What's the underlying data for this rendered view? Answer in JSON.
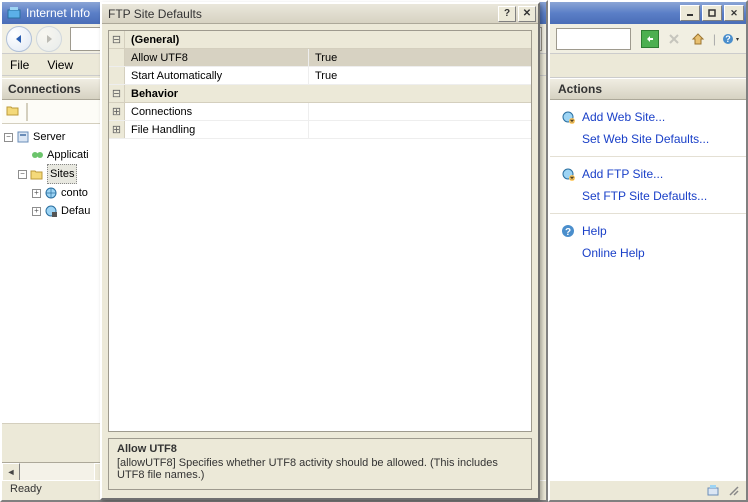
{
  "mainWindow": {
    "title": "Internet Info",
    "menu": {
      "file": "File",
      "view": "View"
    },
    "status": "Ready"
  },
  "connectionsPanel": {
    "header": "Connections",
    "tree": {
      "server": "Server",
      "appPools": "Applicati",
      "sites": "Sites",
      "site1": "conto",
      "site2": "Defau"
    }
  },
  "dialog": {
    "title": "FTP Site Defaults",
    "categories": [
      {
        "exp": "⊟",
        "label": "(General)",
        "rows": [
          {
            "name": "Allow UTF8",
            "value": "True"
          },
          {
            "name": "Start Automatically",
            "value": "True"
          }
        ]
      },
      {
        "exp": "⊟",
        "label": "Behavior",
        "rows": [
          {
            "exp": "⊞",
            "name": "Connections",
            "value": ""
          },
          {
            "exp": "⊞",
            "name": "File Handling",
            "value": ""
          }
        ]
      }
    ],
    "description": {
      "title": "Allow UTF8",
      "body": "[allowUTF8] Specifies whether UTF8 activity should be allowed. (This includes UTF8 file names.)"
    }
  },
  "actionsPanel": {
    "header": "Actions",
    "links": {
      "addWeb": "Add Web Site...",
      "setWebDefaults": "Set Web Site Defaults...",
      "addFtp": "Add FTP Site...",
      "setFtpDefaults": "Set FTP Site Defaults...",
      "help": "Help",
      "onlineHelp": "Online Help"
    }
  }
}
